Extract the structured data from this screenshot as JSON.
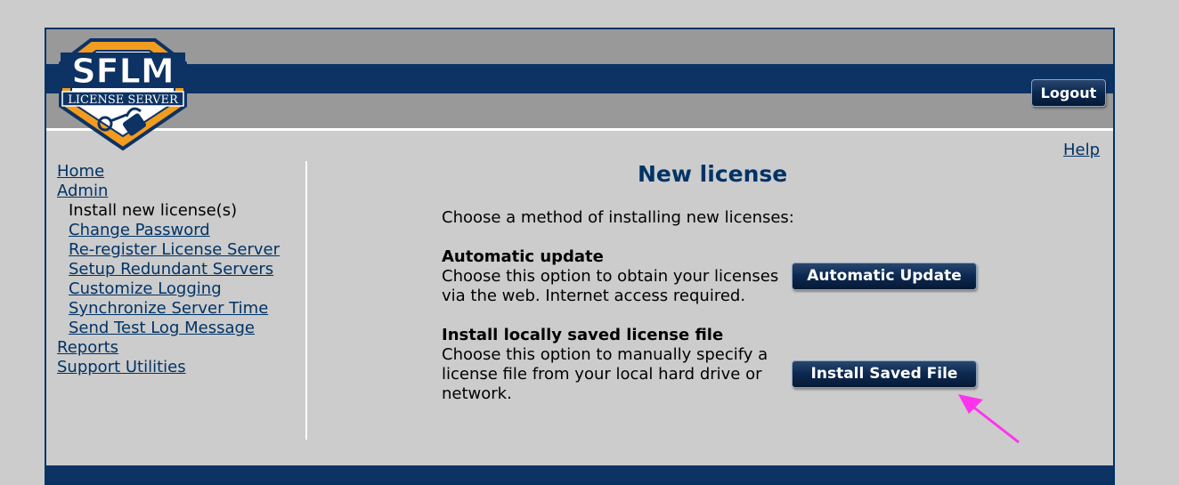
{
  "header": {
    "logo": {
      "title": "SFLM",
      "subtitle": "LICENSE SERVER"
    },
    "logout_label": "Logout"
  },
  "help_label": "Help",
  "sidebar": {
    "items": [
      {
        "label": "Home"
      },
      {
        "label": "Admin"
      },
      {
        "label": "Install new license(s)"
      },
      {
        "label": "Change Password"
      },
      {
        "label": "Re-register License Server"
      },
      {
        "label": "Setup Redundant Servers"
      },
      {
        "label": "Customize Logging"
      },
      {
        "label": "Synchronize Server Time"
      },
      {
        "label": "Send Test Log Message"
      },
      {
        "label": "Reports"
      },
      {
        "label": "Support Utilities"
      }
    ]
  },
  "main": {
    "title": "New license",
    "intro": "Choose a method of installing new licenses:",
    "automatic": {
      "title": "Automatic update",
      "line1": "Choose this option to obtain your licenses",
      "line2": "via the web. Internet access required.",
      "button_label": "Automatic Update"
    },
    "saved": {
      "title": "Install locally saved license file",
      "line1": "Choose this option to manually specify a",
      "line2": "license file from your local hard drive or",
      "line3": "network.",
      "button_label": "Install Saved File"
    }
  },
  "colors": {
    "navy": "#0d3264",
    "link": "#003366",
    "logo_orange": "#f29c1f",
    "annotation_arrow": "#ff33ee"
  }
}
